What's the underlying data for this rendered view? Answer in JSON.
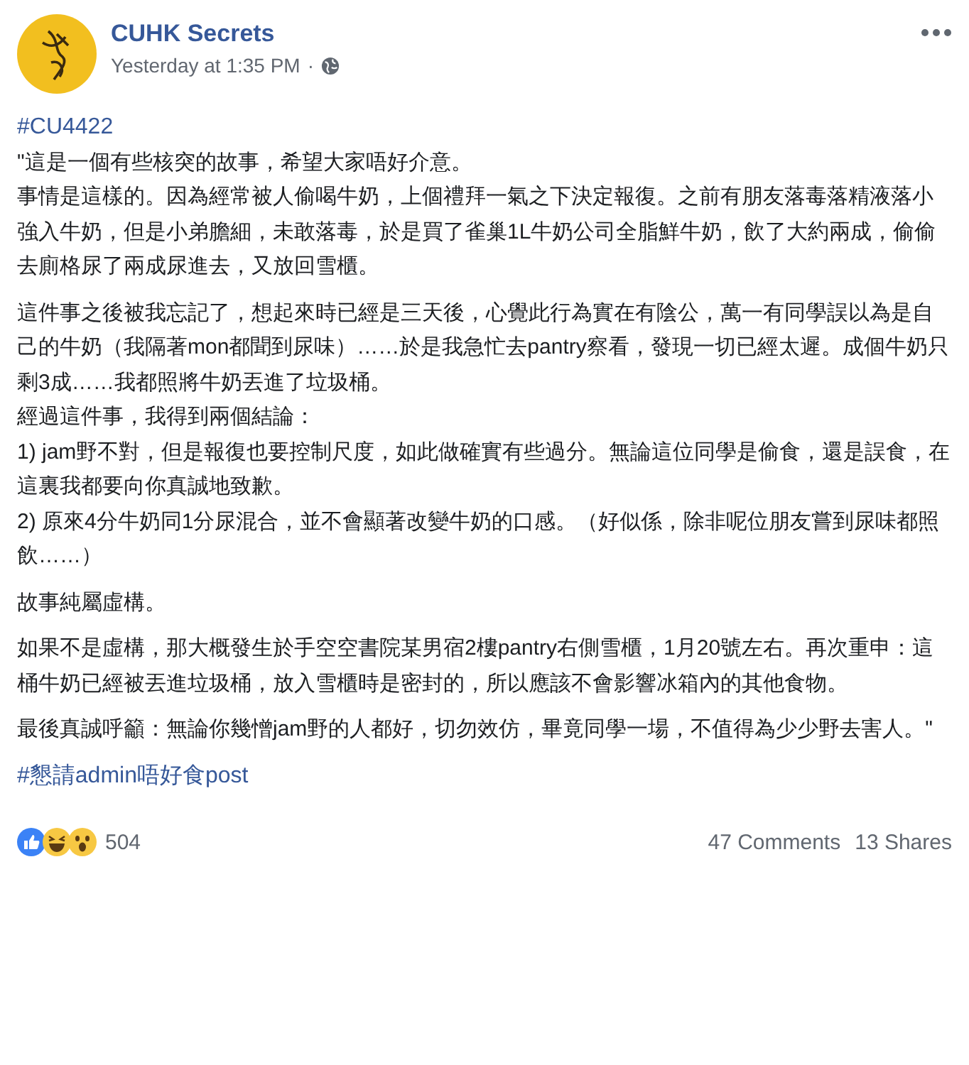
{
  "post": {
    "page_name": "CUHK Secrets",
    "timestamp": "Yesterday at 1:35 PM",
    "separator": "·",
    "tag": "#CU4422",
    "paragraphs": [
      [
        "\"這是一個有些核突的故事，希望大家唔好介意。",
        "事情是這樣的。因為經常被人偷喝牛奶，上個禮拜一氣之下決定報復。之前有朋友落毒落精液落小強入牛奶，但是小弟膽細，未敢落毒，於是買了雀巢1L牛奶公司全脂鮮牛奶，飲了大約兩成，偷偷去廁格尿了兩成尿進去，又放回雪櫃。"
      ],
      [
        "這件事之後被我忘記了，想起來時已經是三天後，心覺此行為實在有陰公，萬一有同學誤以為是自己的牛奶（我隔著mon都聞到尿味）……於是我急忙去pantry察看，發現一切已經太遲。成個牛奶只剩3成……我都照將牛奶丟進了垃圾桶。",
        "經過這件事，我得到兩個結論：",
        "1) jam野不對，但是報復也要控制尺度，如此做確實有些過分。無論這位同學是偷食，還是誤食，在這裏我都要向你真誠地致歉。",
        "2) 原來4分牛奶同1分尿混合，並不會顯著改變牛奶的口感。（好似係，除非呢位朋友嘗到尿味都照飲……）"
      ],
      [
        "故事純屬虛構。"
      ],
      [
        "如果不是虛構，那大概發生於手空空書院某男宿2樓pantry右側雪櫃，1月20號左右。再次重申：這桶牛奶已經被丟進垃圾桶，放入雪櫃時是密封的，所以應該不會影響冰箱內的其他食物。"
      ],
      [
        "最後真誠呼籲：無論你幾憎jam野的人都好，切勿效仿，畢竟同學一場，不值得為少少野去害人。\""
      ]
    ],
    "footer_tag": "#懇請admin唔好食post"
  },
  "reactions": [
    {
      "kind": "like"
    },
    {
      "kind": "haha"
    },
    {
      "kind": "wow"
    }
  ],
  "reaction_count": "504",
  "comments": "47 Comments",
  "shares": "13 Shares"
}
